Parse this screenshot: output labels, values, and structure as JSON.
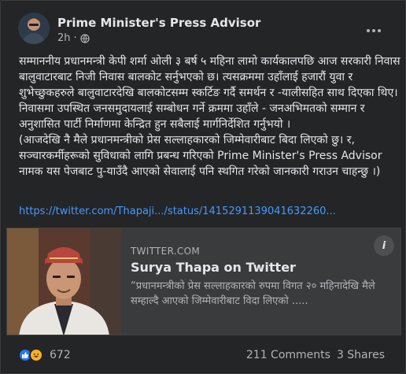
{
  "post": {
    "author": "Prime Minister's Press Advisor",
    "time": "2h",
    "privacy_icon": "globe-icon",
    "body_paragraphs": [
      "सम्माननीय प्रधानमन्त्री केपी शर्मा ओली ३ बर्ष ५ महिना लामो कार्यकालपछि आज सरकारी निवास बालुवाटारबाट निजी निवास बालकोट सर्नुभएको छ। त्यसक्रममा उहाँलाई हजारौं युवा र शुभेच्छुकहरुले बालुवाटारदेखि बालकोटसम्म स्कर्टिङ गर्दै समर्थन र -यालीसहित साथ दिएका थिए। निवासमा उपस्थित जनसमुदायलाई सम्बोधन गर्ने क्रममा उहाँले - जनअभिमतको सम्मान र अनुशासित पार्टी निर्माणमा केन्द्रित हुन सबैलाई मार्गनिर्देशित गर्नुभयो ।",
      "(आजदेखि नै मैले प्रधानमन्त्रीको प्रेस सल्लाहकारको जिम्मेवारीबाट बिदा लिएको छु। र, सञ्चारकर्मीहरूको सुविधाको लागि प्रबन्ध गरिएको Prime Minister's Press Advisor नामक यस  पेजबाट पु-याउँदै आएको सेवालाई पनि स्थगित गरेको जानकारी गराउन चाहन्छु ।)"
    ],
    "link": "https://twitter.com/Thapaji.../status/1415291139041632260..."
  },
  "preview": {
    "domain": "TWITTER.COM",
    "title": "Surya Thapa on Twitter",
    "description": "“प्रधानमन्त्रीको प्रेस सल्लाहकारको रुपमा विगत २० महिनादेखि मैले सम्हाल्दै आएको जिम्मेवारीबाट विदा लिएको .....",
    "info_label": "i"
  },
  "engagement": {
    "reaction_count": "672",
    "comments": "211 Comments",
    "shares": "3 Shares"
  },
  "colors": {
    "background": "#242526",
    "text": "#e4e6eb",
    "muted": "#b0b3b8",
    "link": "#4599ff",
    "like": "#2078f4",
    "haha": "#f7b125"
  }
}
